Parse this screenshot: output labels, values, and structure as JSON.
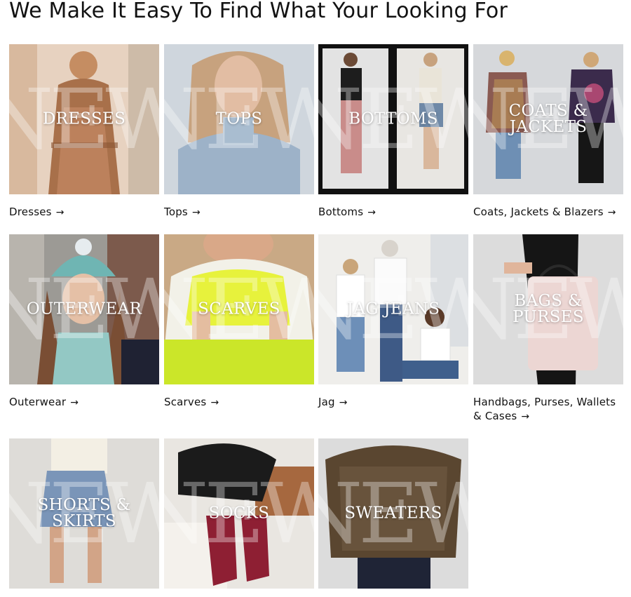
{
  "page": {
    "title": "We Make It Easy To Find What Your Looking For"
  },
  "overlay_word": "NEW",
  "categories": [
    {
      "tile_label": "DRESSES",
      "link": "Dresses",
      "icon": "arrow-right-icon"
    },
    {
      "tile_label": "TOPS",
      "link": "Tops",
      "icon": "arrow-right-icon"
    },
    {
      "tile_label": "BOTTOMS",
      "link": "Bottoms",
      "icon": "arrow-right-icon"
    },
    {
      "tile_label": "COATS & JACKETS",
      "link": "Coats, Jackets & Blazers",
      "icon": "arrow-right-icon"
    },
    {
      "tile_label": "OUTERWEAR",
      "link": "Outerwear",
      "icon": "arrow-right-icon"
    },
    {
      "tile_label": "SCARVES",
      "link": "Scarves",
      "icon": "arrow-right-icon"
    },
    {
      "tile_label": "JAG JEANS",
      "link": "Jag",
      "icon": "arrow-right-icon"
    },
    {
      "tile_label": "BAGS & PURSES",
      "link": "Handbags, Purses, Wallets & Cases",
      "icon": "arrow-right-icon"
    },
    {
      "tile_label": "SHORTS & SKIRTS",
      "link": "",
      "icon": ""
    },
    {
      "tile_label": "SOCKS",
      "link": "",
      "icon": ""
    },
    {
      "tile_label": "SWEATERS",
      "link": "",
      "icon": ""
    }
  ],
  "arrow_glyph": "→"
}
